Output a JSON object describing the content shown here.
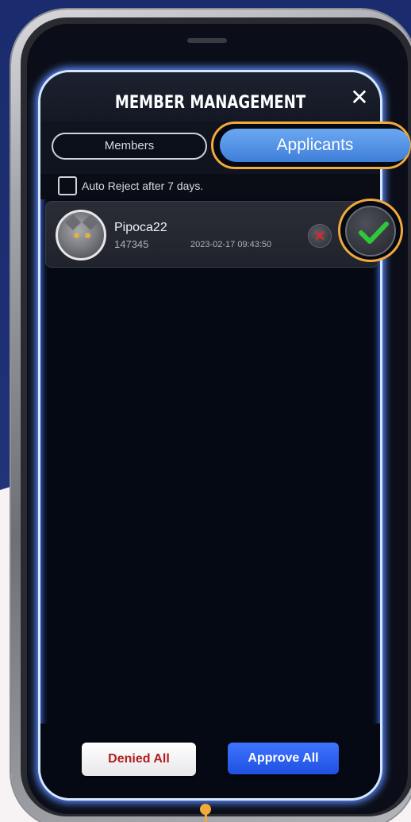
{
  "header": {
    "title": "MEMBER MANAGEMENT",
    "close_icon": "close-icon"
  },
  "tabs": {
    "members_label": "Members",
    "applicants_label": "Applicants",
    "active": "Applicants"
  },
  "auto_reject": {
    "label": "Auto Reject after 7 days.",
    "checked": false
  },
  "applicants": [
    {
      "name": "Pipoca22",
      "id": "147345",
      "date": "2023-02-17 09:43:50"
    }
  ],
  "actions": {
    "denied_all_label": "Denied All",
    "approve_all_label": "Approve All"
  },
  "colors": {
    "highlight": "#f2a83b",
    "tab_active": "#4a8ae0",
    "approve_all": "#2a5cf0",
    "reject": "#e02828",
    "accept": "#2ec93a"
  }
}
